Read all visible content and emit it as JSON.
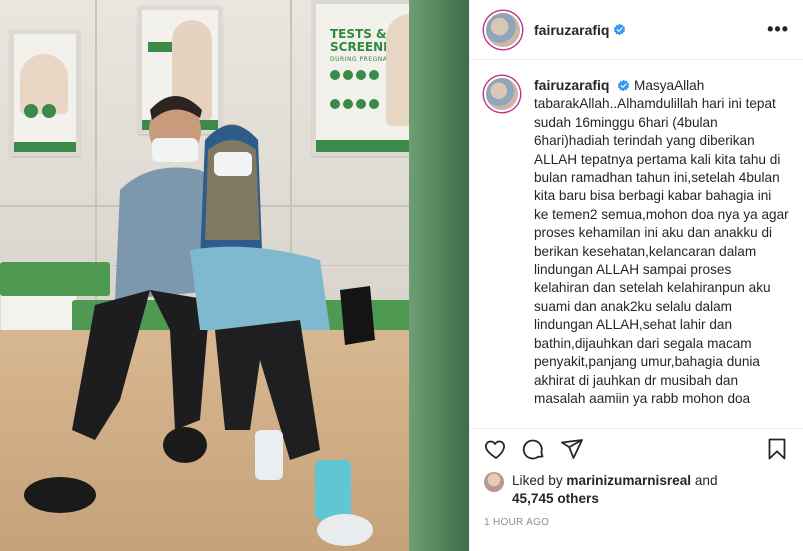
{
  "post": {
    "username": "fairuzarafiq",
    "verified": true,
    "more_icon": "more-horizontal-icon",
    "poster": {
      "title_line1": "TESTS &",
      "title_line2": "SCREENINGS",
      "subtitle": "DURING PREGNANCY"
    },
    "caption": {
      "username": "fairuzarafiq",
      "text": "MasyaAllah tabarakAllah..Alhamdulillah hari ini tepat sudah 16minggu 6hari (4bulan 6hari)hadiah terindah yang diberikan ALLAH tepatnya pertama kali kita tahu di bulan ramadhan tahun ini,setelah 4bulan kita baru bisa berbagi kabar bahagia ini ke temen2 semua,mohon doa nya ya agar proses kehamilan ini aku dan anakku di berikan kesehatan,kelancaran dalam lindungan ALLAH sampai proses kelahiran dan setelah kelahiranpun aku suami dan anak2ku selalu dalam lindungan ALLAH,sehat lahir dan bathin,dijauhkan dari segala macam penyakit,panjang umur,bahagia dunia akhirat di jauhkan dr musibah dan masalah aamiin ya rabb mohon doa"
    },
    "actions": {
      "like_icon": "heart-icon",
      "comment_icon": "comment-icon",
      "share_icon": "share-icon",
      "save_icon": "bookmark-icon"
    },
    "likes": {
      "prefix": "Liked by ",
      "liker": "marinizumarnisreal",
      "conj": " and",
      "count": "45,745 others"
    },
    "timestamp": "1 HOUR AGO"
  },
  "colors": {
    "verified_badge": "#3897f0",
    "text": "#262626",
    "muted": "#8e8e8e",
    "border": "#efefef"
  }
}
